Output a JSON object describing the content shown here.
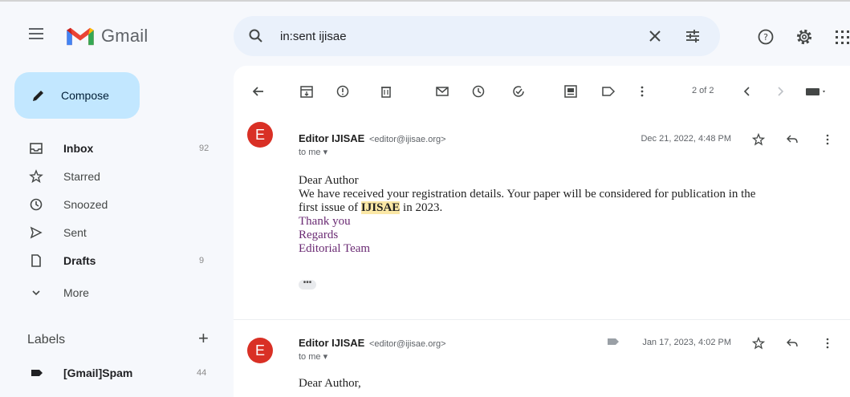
{
  "app": {
    "name": "Gmail",
    "colors": {
      "accent": "#c2e7ff",
      "avatar": "#d93025",
      "highlight": "#fbe8a6",
      "signature": "#6a2a73"
    }
  },
  "search": {
    "value": "in:sent ijisae",
    "icons": [
      "search-icon",
      "clear-icon",
      "tune-icon"
    ]
  },
  "header_icons": [
    "help-icon",
    "gear-icon",
    "apps-icon"
  ],
  "compose": {
    "label": "Compose"
  },
  "nav": [
    {
      "id": "inbox",
      "label": "Inbox",
      "count": "92",
      "bold": true,
      "icon": "inbox-icon"
    },
    {
      "id": "starred",
      "label": "Starred",
      "count": "",
      "bold": false,
      "icon": "star-icon"
    },
    {
      "id": "snoozed",
      "label": "Snoozed",
      "count": "",
      "bold": false,
      "icon": "clock-icon"
    },
    {
      "id": "sent",
      "label": "Sent",
      "count": "",
      "bold": false,
      "icon": "send-icon"
    },
    {
      "id": "drafts",
      "label": "Drafts",
      "count": "9",
      "bold": true,
      "icon": "draft-icon"
    },
    {
      "id": "more",
      "label": "More",
      "count": "",
      "bold": false,
      "icon": "chevron-down-icon"
    }
  ],
  "labels": {
    "title": "Labels",
    "add": "+",
    "items": [
      {
        "name": "[Gmail]Spam",
        "count": "44"
      }
    ]
  },
  "toolbar": {
    "icons": [
      "back-icon",
      "archive-icon",
      "report-spam-icon",
      "delete-icon",
      "mark-unread-icon",
      "snooze-icon",
      "add-task-icon",
      "move-to-icon",
      "label-icon",
      "more-icon"
    ],
    "pager": "2 of 2"
  },
  "messages": [
    {
      "avatar": "E",
      "sender_name": "Editor IJISAE",
      "sender_email": "<editor@ijisae.org>",
      "to": "to me ▾",
      "date": "Dec 21, 2022, 4:48 PM",
      "body": {
        "line1": "Dear Author",
        "line2": "We have received your registration details. Your paper will be considered for publication in the",
        "line3_pre": "first issue of ",
        "line3_hl": "IJISAE",
        "line3_post": " in 2023.",
        "line4": "Thank you",
        "sig1": "Regards",
        "sig2": "Editorial Team"
      },
      "trimmed": "•••"
    },
    {
      "avatar": "E",
      "sender_name": "Editor IJISAE",
      "sender_email": "<editor@ijisae.org>",
      "to": "to me ▾",
      "date": "Jan 17, 2023, 4:02 PM",
      "has_label_tag": true,
      "body": {
        "line1": "Dear Author,"
      }
    }
  ]
}
